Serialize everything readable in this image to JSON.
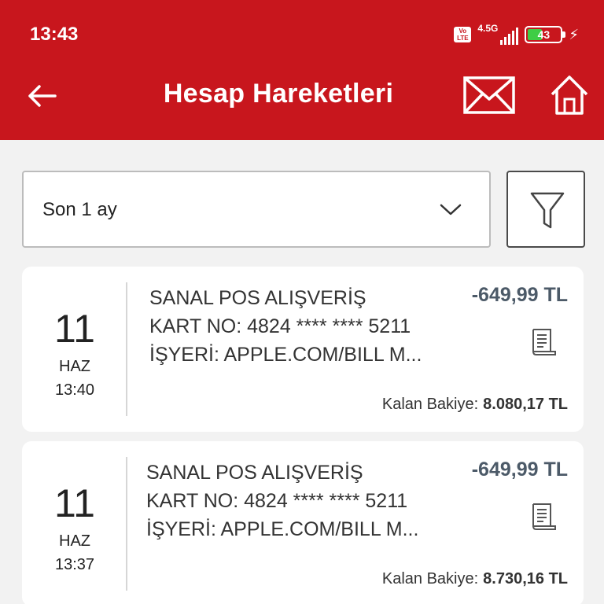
{
  "status_bar": {
    "time": "13:43",
    "volte_line1": "Vo",
    "volte_line2": "LTE",
    "network": "4.5G",
    "battery_level": "43",
    "battery_fraction": 0.43
  },
  "header": {
    "title": "Hesap Hareketleri",
    "icons": [
      "back-arrow-icon",
      "mail-icon",
      "home-icon"
    ]
  },
  "filter": {
    "period_selected": "Son 1 ay",
    "icons": [
      "chevron-down-icon",
      "filter-funnel-icon"
    ]
  },
  "transactions": [
    {
      "day": "11",
      "month": "HAZ",
      "time": "13:40",
      "line1": "SANAL POS ALIŞVERİŞ",
      "line2": "KART NO: 4824 **** **** 5211",
      "line3": "İŞYERİ: APPLE.COM/BILL  M...",
      "amount": "-649,99 TL",
      "balance_label": "Kalan Bakiye:",
      "balance_value": "8.080,17 TL"
    },
    {
      "day": "11",
      "month": "HAZ",
      "time": "13:37",
      "line1": "SANAL POS ALIŞVERİŞ",
      "line2": "KART NO: 4824 **** **** 5211",
      "line3": "İŞYERİ: APPLE.COM/BILL  M...",
      "amount": "-649,99 TL",
      "balance_label": "Kalan Bakiye:",
      "balance_value": "8.730,16 TL"
    }
  ],
  "colors": {
    "brand_red": "#c8161d",
    "amount_text": "#4c5a68",
    "background": "#f2f2f2",
    "battery_fill": "#3fcd45"
  }
}
